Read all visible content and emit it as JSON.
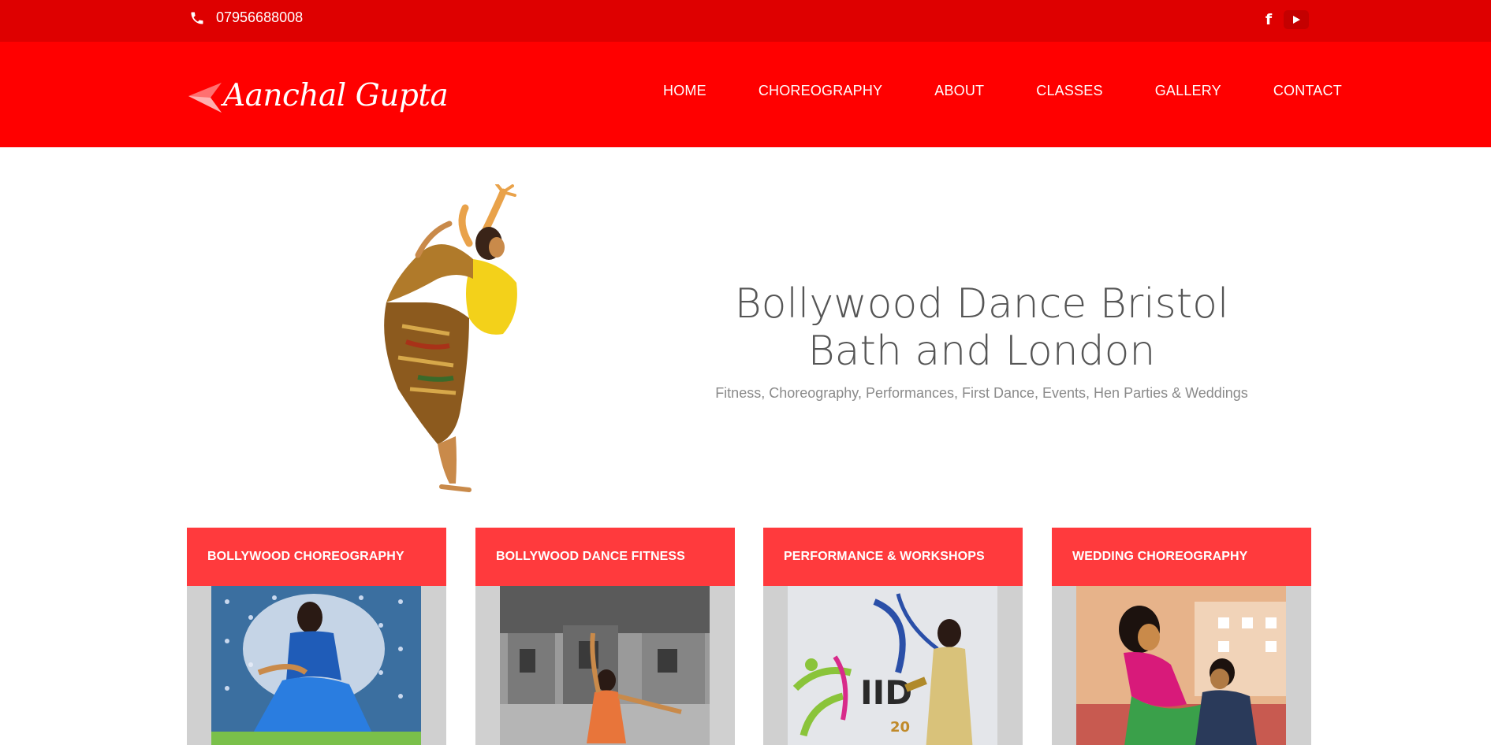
{
  "topbar": {
    "phone_icon": "phone-icon",
    "phone_number": "07956688008",
    "social": [
      {
        "name": "facebook-icon"
      },
      {
        "name": "youtube-icon"
      }
    ]
  },
  "header": {
    "logo_text": "Aanchal Gupta",
    "nav": [
      {
        "label": "HOME"
      },
      {
        "label": "CHOREOGRAPHY"
      },
      {
        "label": "ABOUT"
      },
      {
        "label": "CLASSES"
      },
      {
        "label": "GALLERY"
      },
      {
        "label": "CONTACT"
      }
    ]
  },
  "hero": {
    "title_line1": "Bollywood Dance Bristol",
    "title_line2": "Bath and London",
    "subtitle": "Fitness, Choreography, Performances, First Dance, Events, Hen Parties & Weddings"
  },
  "cards": [
    {
      "title": "BOLLYWOOD CHOREOGRAPHY"
    },
    {
      "title": "BOLLYWOOD DANCE FITNESS"
    },
    {
      "title": "PERFORMANCE & WORKSHOPS"
    },
    {
      "title": "WEDDING CHOREOGRAPHY"
    }
  ],
  "colors": {
    "topbar_bg": "#de0000",
    "header_bg": "#ff0000",
    "card_header_bg": "#ff3a3d",
    "card_body_bg": "#d0d0d0",
    "hero_title": "#555555",
    "hero_subtitle": "#8a8a8a"
  }
}
